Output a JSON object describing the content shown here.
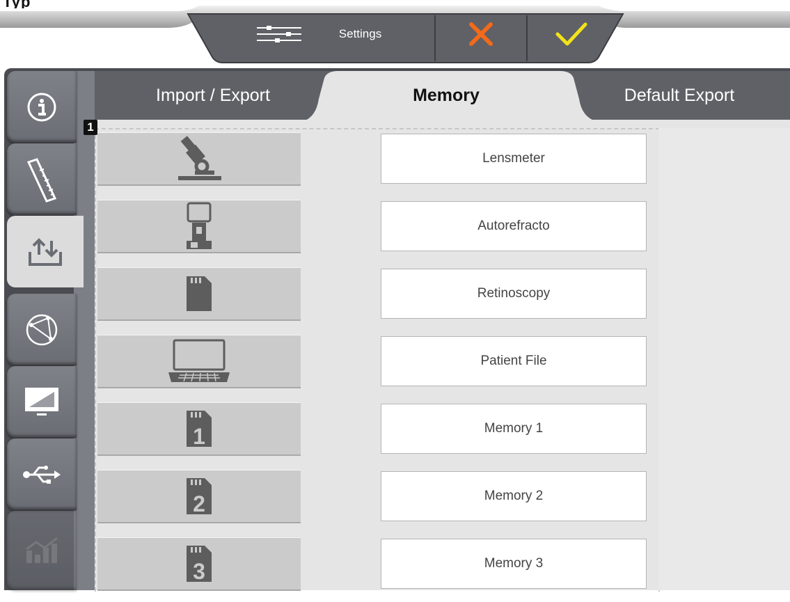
{
  "header": {
    "settings_label": "Settings",
    "cancel_icon": "close-icon",
    "confirm_icon": "check-icon",
    "colors": {
      "cancel": "#f26a1b",
      "confirm": "#f2e21b",
      "bar": "#5f6166"
    }
  },
  "rail": {
    "items": [
      {
        "name": "info-icon",
        "active": false
      },
      {
        "name": "ruler-icon",
        "active": false
      },
      {
        "name": "import-export-icon",
        "active": true
      },
      {
        "name": "network-icon",
        "active": false
      },
      {
        "name": "display-icon",
        "active": false
      },
      {
        "name": "usb-icon",
        "active": false
      },
      {
        "name": "chart-icon",
        "active": false,
        "disabled": true
      }
    ]
  },
  "tabs": [
    {
      "label": "Import / Export",
      "active": false
    },
    {
      "label": "Memory",
      "active": true
    },
    {
      "label": "Default Export",
      "active": false
    }
  ],
  "badge": "1",
  "memory_rows": [
    {
      "icon": "lensmeter-icon",
      "name": "Lensmeter"
    },
    {
      "icon": "autorefractometer-icon",
      "name": "Autorefracto"
    },
    {
      "icon": "sd-card-icon",
      "name": "Retinoscopy"
    },
    {
      "icon": "laptop-icon",
      "name": "Patient File"
    },
    {
      "icon": "memory-1-icon",
      "name": "Memory 1",
      "number": "1"
    },
    {
      "icon": "memory-2-icon",
      "name": "Memory 2",
      "number": "2"
    },
    {
      "icon": "memory-3-icon",
      "name": "Memory 3",
      "number": "3"
    }
  ]
}
